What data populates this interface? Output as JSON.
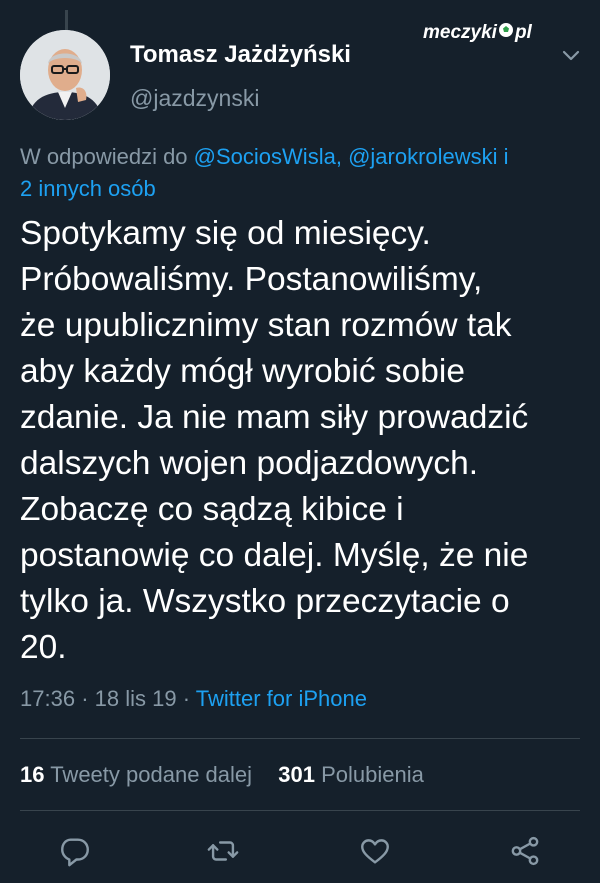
{
  "author": {
    "name": "Tomasz Jażdżyński",
    "handle": "@jazdzynski"
  },
  "watermark": {
    "left": "meczyki",
    "right": "pl"
  },
  "reply": {
    "prefix": "W odpowiedzi do",
    "mention1": "@SociosWisla,",
    "mention2": "@jarokrolewski",
    "connector": "i",
    "others": "2 innych osób"
  },
  "tweet": {
    "text": "Spotykamy się od miesięcy.\nPróbowaliśmy. Postanowiliśmy,\nże upublicznimy stan rozmów tak\naby każdy mógł wyrobić sobie\nzdanie. Ja nie mam siły prowadzić\ndalszych wojen podjazdowych.\nZobaczę co sądzą kibice i\npostanowię co dalej. Myślę, że nie\ntylko ja. Wszystko przeczytacie o\n20."
  },
  "meta": {
    "time": "17:36",
    "date": "18 lis 19",
    "separator": "·",
    "source": "Twitter for iPhone"
  },
  "stats": {
    "retweets_count": "16",
    "retweets_label": "Tweety podane dalej",
    "likes_count": "301",
    "likes_label": "Polubienia"
  },
  "icons": {
    "reply": "reply-icon",
    "retweet": "retweet-icon",
    "like": "heart-icon",
    "share": "share-icon",
    "menu": "chevron-down-icon"
  },
  "colors": {
    "background": "#15202b",
    "text": "#ffffff",
    "secondary": "#8899a6",
    "link": "#1da1f2",
    "divider": "#38444d"
  }
}
